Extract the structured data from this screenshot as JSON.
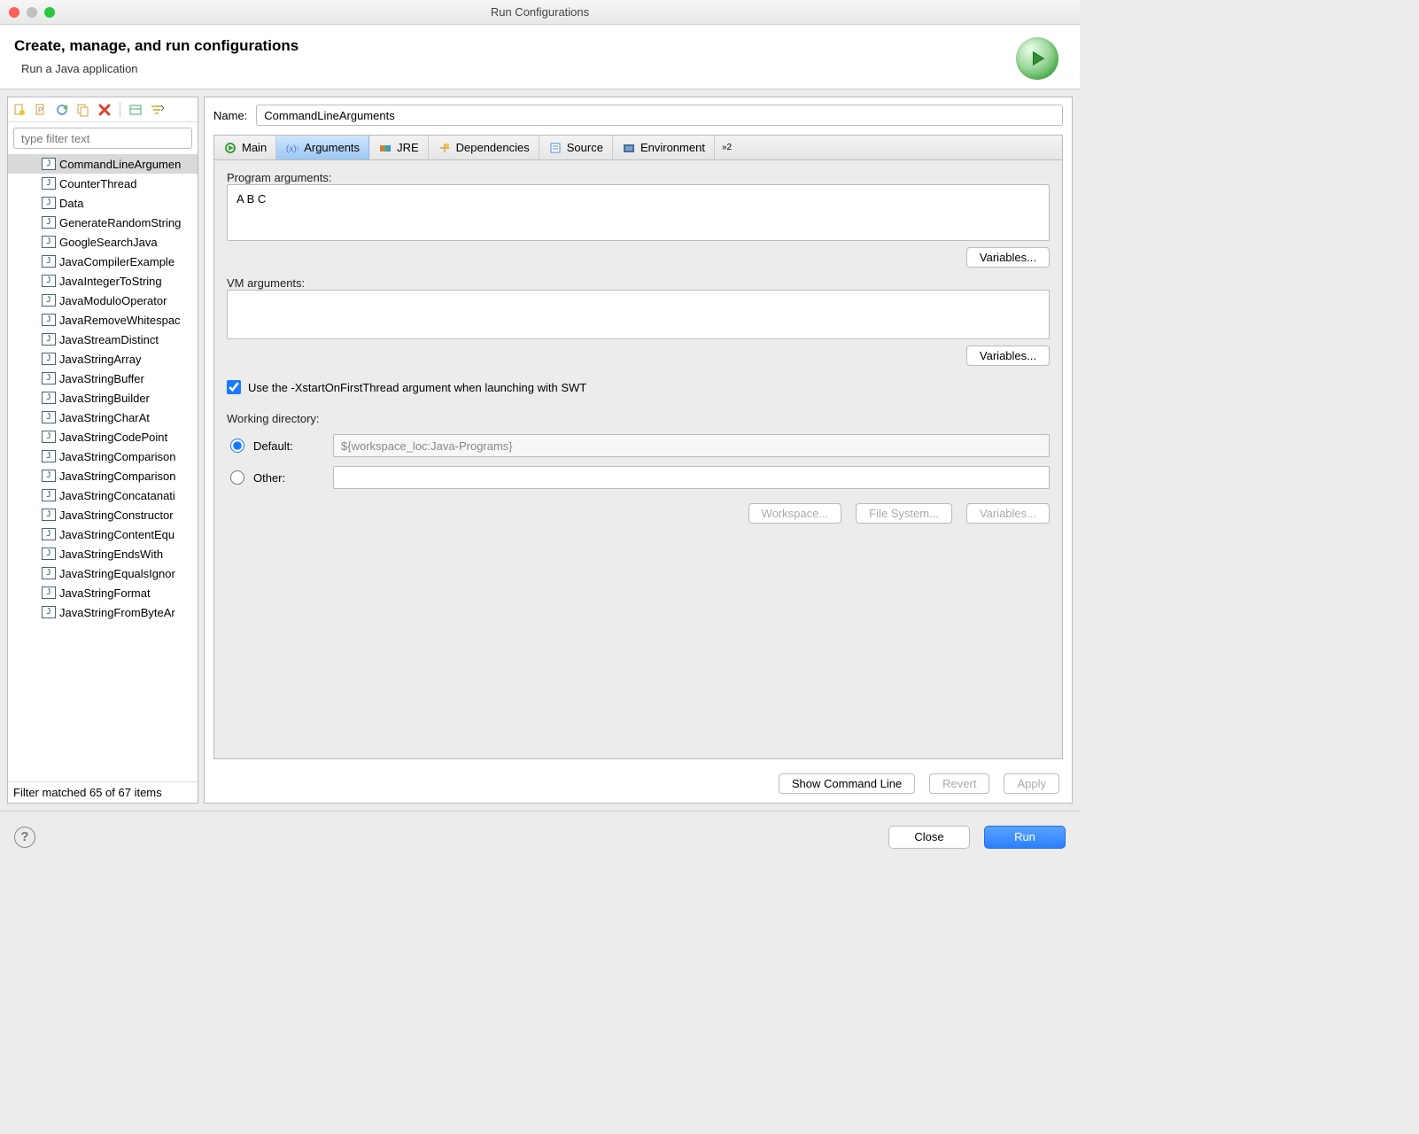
{
  "window": {
    "title": "Run Configurations"
  },
  "header": {
    "title": "Create, manage, and run configurations",
    "subtitle": "Run a Java application"
  },
  "sidebar": {
    "filter_placeholder": "type filter text",
    "items": [
      "CommandLineArgumen",
      "CounterThread",
      "Data",
      "GenerateRandomString",
      "GoogleSearchJava",
      "JavaCompilerExample",
      "JavaIntegerToString",
      "JavaModuloOperator",
      "JavaRemoveWhitespac",
      "JavaStreamDistinct",
      "JavaStringArray",
      "JavaStringBuffer",
      "JavaStringBuilder",
      "JavaStringCharAt",
      "JavaStringCodePoint",
      "JavaStringComparison",
      "JavaStringComparison",
      "JavaStringConcatanati",
      "JavaStringConstructor",
      "JavaStringContentEqu",
      "JavaStringEndsWith",
      "JavaStringEqualsIgnor",
      "JavaStringFormat",
      "JavaStringFromByteAr"
    ],
    "selected_index": 0,
    "filter_status": "Filter matched 65 of 67 items"
  },
  "form": {
    "name_label": "Name:",
    "name_value": "CommandLineArguments"
  },
  "tabs": {
    "items": [
      "Main",
      "Arguments",
      "JRE",
      "Dependencies",
      "Source",
      "Environment"
    ],
    "active_index": 1,
    "overflow": "2"
  },
  "args": {
    "program_label": "Program arguments:",
    "program_value": "A B C",
    "variables_btn": "Variables...",
    "vm_label": "VM arguments:",
    "vm_value": "",
    "swt_checkbox_label": "Use the -XstartOnFirstThread argument when launching with SWT",
    "swt_checked": true
  },
  "workdir": {
    "label": "Working directory:",
    "default_label": "Default:",
    "default_value": "${workspace_loc:Java-Programs}",
    "other_label": "Other:",
    "other_value": "",
    "btns": {
      "workspace": "Workspace...",
      "filesystem": "File System...",
      "variables": "Variables..."
    },
    "selected": "default"
  },
  "bottom": {
    "show_cmd": "Show Command Line",
    "revert": "Revert",
    "apply": "Apply"
  },
  "footer": {
    "close": "Close",
    "run": "Run"
  }
}
